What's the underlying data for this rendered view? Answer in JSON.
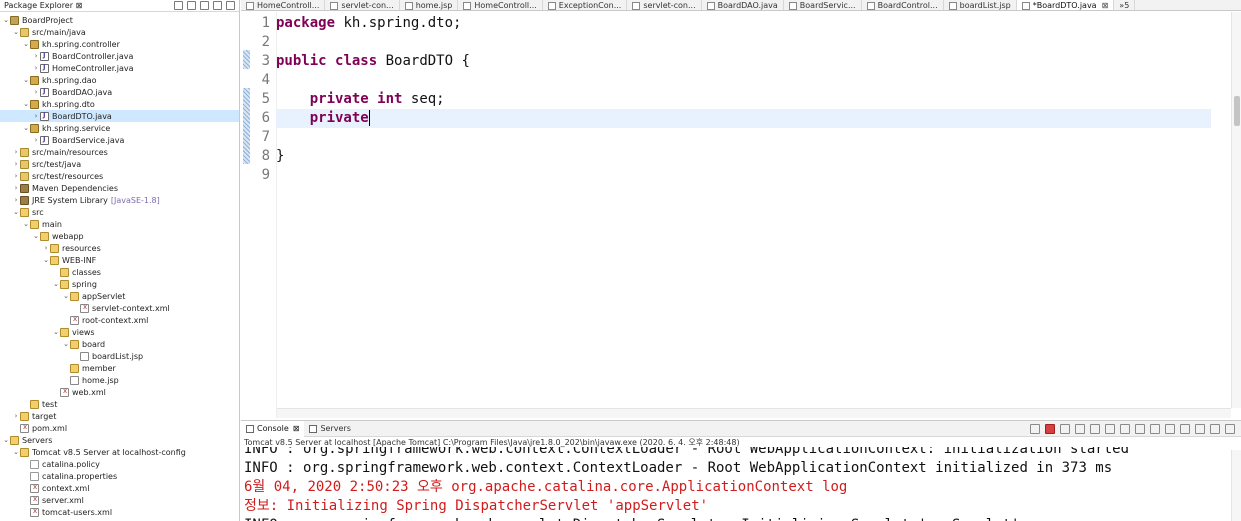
{
  "explorer": {
    "title": "Package Explorer",
    "tab_suffix": "⊠",
    "tree": [
      {
        "label": "BoardProject",
        "icon": "project-icon",
        "depth": 0,
        "twisty": "v"
      },
      {
        "label": "src/main/java",
        "icon": "source-folder-icon",
        "depth": 1,
        "twisty": "v"
      },
      {
        "label": "kh.spring.controller",
        "icon": "package-icon",
        "depth": 2,
        "twisty": "v"
      },
      {
        "label": "BoardController.java",
        "icon": "java-file-icon",
        "depth": 3,
        "twisty": ">"
      },
      {
        "label": "HomeController.java",
        "icon": "java-file-icon",
        "depth": 3,
        "twisty": ">"
      },
      {
        "label": "kh.spring.dao",
        "icon": "package-icon",
        "depth": 2,
        "twisty": "v"
      },
      {
        "label": "BoardDAO.java",
        "icon": "java-file-icon",
        "depth": 3,
        "twisty": ">"
      },
      {
        "label": "kh.spring.dto",
        "icon": "package-icon",
        "depth": 2,
        "twisty": "v"
      },
      {
        "label": "BoardDTO.java",
        "icon": "java-file-icon",
        "depth": 3,
        "twisty": ">",
        "selected": true
      },
      {
        "label": "kh.spring.service",
        "icon": "package-icon",
        "depth": 2,
        "twisty": "v"
      },
      {
        "label": "BoardService.java",
        "icon": "java-file-icon",
        "depth": 3,
        "twisty": ">"
      },
      {
        "label": "src/main/resources",
        "icon": "source-folder-icon",
        "depth": 1,
        "twisty": ">"
      },
      {
        "label": "src/test/java",
        "icon": "source-folder-icon",
        "depth": 1,
        "twisty": ">"
      },
      {
        "label": "src/test/resources",
        "icon": "source-folder-icon",
        "depth": 1,
        "twisty": ">"
      },
      {
        "label": "Maven Dependencies",
        "icon": "library-icon",
        "depth": 1,
        "twisty": ">"
      },
      {
        "label": "JRE System Library",
        "icon": "library-icon",
        "depth": 1,
        "twisty": ">",
        "suffix": "[JavaSE-1.8]"
      },
      {
        "label": "src",
        "icon": "folder-icon",
        "depth": 1,
        "twisty": "v"
      },
      {
        "label": "main",
        "icon": "folder-icon",
        "depth": 2,
        "twisty": "v"
      },
      {
        "label": "webapp",
        "icon": "folder-icon",
        "depth": 3,
        "twisty": "v"
      },
      {
        "label": "resources",
        "icon": "folder-icon",
        "depth": 4,
        "twisty": ">"
      },
      {
        "label": "WEB-INF",
        "icon": "folder-icon",
        "depth": 4,
        "twisty": "v"
      },
      {
        "label": "classes",
        "icon": "folder-icon",
        "depth": 5,
        "twisty": ""
      },
      {
        "label": "spring",
        "icon": "folder-icon",
        "depth": 5,
        "twisty": "v"
      },
      {
        "label": "appServlet",
        "icon": "folder-icon",
        "depth": 6,
        "twisty": "v"
      },
      {
        "label": "servlet-context.xml",
        "icon": "xml-file-icon",
        "depth": 7,
        "twisty": ""
      },
      {
        "label": "root-context.xml",
        "icon": "xml-file-icon",
        "depth": 6,
        "twisty": ""
      },
      {
        "label": "views",
        "icon": "folder-icon",
        "depth": 5,
        "twisty": "v"
      },
      {
        "label": "board",
        "icon": "folder-icon",
        "depth": 6,
        "twisty": "v"
      },
      {
        "label": "boardList.jsp",
        "icon": "jsp-file-icon",
        "depth": 7,
        "twisty": ""
      },
      {
        "label": "member",
        "icon": "folder-icon",
        "depth": 6,
        "twisty": ""
      },
      {
        "label": "home.jsp",
        "icon": "jsp-file-icon",
        "depth": 6,
        "twisty": ""
      },
      {
        "label": "web.xml",
        "icon": "xml-file-icon",
        "depth": 5,
        "twisty": ""
      },
      {
        "label": "test",
        "icon": "folder-icon",
        "depth": 2,
        "twisty": ""
      },
      {
        "label": "target",
        "icon": "folder-icon",
        "depth": 1,
        "twisty": ">"
      },
      {
        "label": "pom.xml",
        "icon": "xml-file-icon",
        "depth": 1,
        "twisty": ""
      },
      {
        "label": "Servers",
        "icon": "folder-icon",
        "depth": 0,
        "twisty": "v"
      },
      {
        "label": "Tomcat v8.5 Server at localhost-config",
        "icon": "folder-icon",
        "depth": 1,
        "twisty": "v"
      },
      {
        "label": "catalina.policy",
        "icon": "file-icon",
        "depth": 2,
        "twisty": ""
      },
      {
        "label": "catalina.properties",
        "icon": "file-icon",
        "depth": 2,
        "twisty": ""
      },
      {
        "label": "context.xml",
        "icon": "xml-file-icon",
        "depth": 2,
        "twisty": ""
      },
      {
        "label": "server.xml",
        "icon": "xml-file-icon",
        "depth": 2,
        "twisty": ""
      },
      {
        "label": "tomcat-users.xml",
        "icon": "xml-file-icon",
        "depth": 2,
        "twisty": ""
      }
    ]
  },
  "editor": {
    "tabs": [
      {
        "label": "HomeControll...",
        "active": false
      },
      {
        "label": "servlet-con...",
        "active": false
      },
      {
        "label": "home.jsp",
        "active": false
      },
      {
        "label": "HomeControll...",
        "active": false
      },
      {
        "label": "ExceptionCon...",
        "active": false
      },
      {
        "label": "servlet-con...",
        "active": false
      },
      {
        "label": "BoardDAO.java",
        "active": false
      },
      {
        "label": "BoardServic...",
        "active": false
      },
      {
        "label": "BoardControl...",
        "active": false
      },
      {
        "label": "boardList.jsp",
        "active": false
      },
      {
        "label": "*BoardDTO.java",
        "active": true
      },
      {
        "label": "»5",
        "active": false
      }
    ],
    "close_glyph": "⊠",
    "lines": [
      {
        "num": "1",
        "tokens": [
          {
            "t": "package",
            "kw": true
          },
          {
            "t": " kh.spring.dto;",
            "kw": false
          }
        ]
      },
      {
        "num": "2",
        "tokens": []
      },
      {
        "num": "3",
        "tokens": [
          {
            "t": "public",
            "kw": true
          },
          {
            "t": " ",
            "kw": false
          },
          {
            "t": "class",
            "kw": true
          },
          {
            "t": " BoardDTO {",
            "kw": false
          }
        ]
      },
      {
        "num": "4",
        "tokens": []
      },
      {
        "num": "5",
        "tokens": [
          {
            "t": "    ",
            "kw": false
          },
          {
            "t": "private",
            "kw": true
          },
          {
            "t": " ",
            "kw": false
          },
          {
            "t": "int",
            "kw": true
          },
          {
            "t": " seq;",
            "kw": false
          }
        ]
      },
      {
        "num": "6",
        "tokens": [
          {
            "t": "    ",
            "kw": false
          },
          {
            "t": "private",
            "kw": true
          }
        ],
        "current": true,
        "caret": true
      },
      {
        "num": "7",
        "tokens": []
      },
      {
        "num": "8",
        "tokens": [
          {
            "t": "}",
            "kw": false
          }
        ]
      },
      {
        "num": "9",
        "tokens": []
      }
    ]
  },
  "console": {
    "tabs": [
      {
        "label": "Console",
        "active": true,
        "suffix": "⊠"
      },
      {
        "label": "Servers",
        "active": false
      }
    ],
    "description": "Tomcat v8.5 Server at localhost [Apache Tomcat] C:\\Program Files\\Java\\jre1.8.0_202\\bin\\javaw.exe (2020. 6. 4. 오후 2:48:48)",
    "lines": [
      {
        "text": "INFO : org.springframework.web.context.ContextLoader - Root WebApplicationContext: initialization started",
        "red": false,
        "clipped": true
      },
      {
        "text": "INFO : org.springframework.web.context.ContextLoader - Root WebApplicationContext initialized in 373 ms",
        "red": false
      },
      {
        "text": "6월 04, 2020 2:50:23 오후 org.apache.catalina.core.ApplicationContext log",
        "red": true
      },
      {
        "text": "정보: Initializing Spring DispatcherServlet 'appServlet'",
        "red": true
      },
      {
        "text": "INFO : org.springframework.web.servlet.DispatcherServlet - Initializing Servlet 'appServlet'",
        "red": false
      }
    ]
  },
  "colors": {
    "keyword": "#7f0055",
    "current_line": "#e8f2fe",
    "console_error": "#d01c1c",
    "selection": "#cde8ff"
  }
}
